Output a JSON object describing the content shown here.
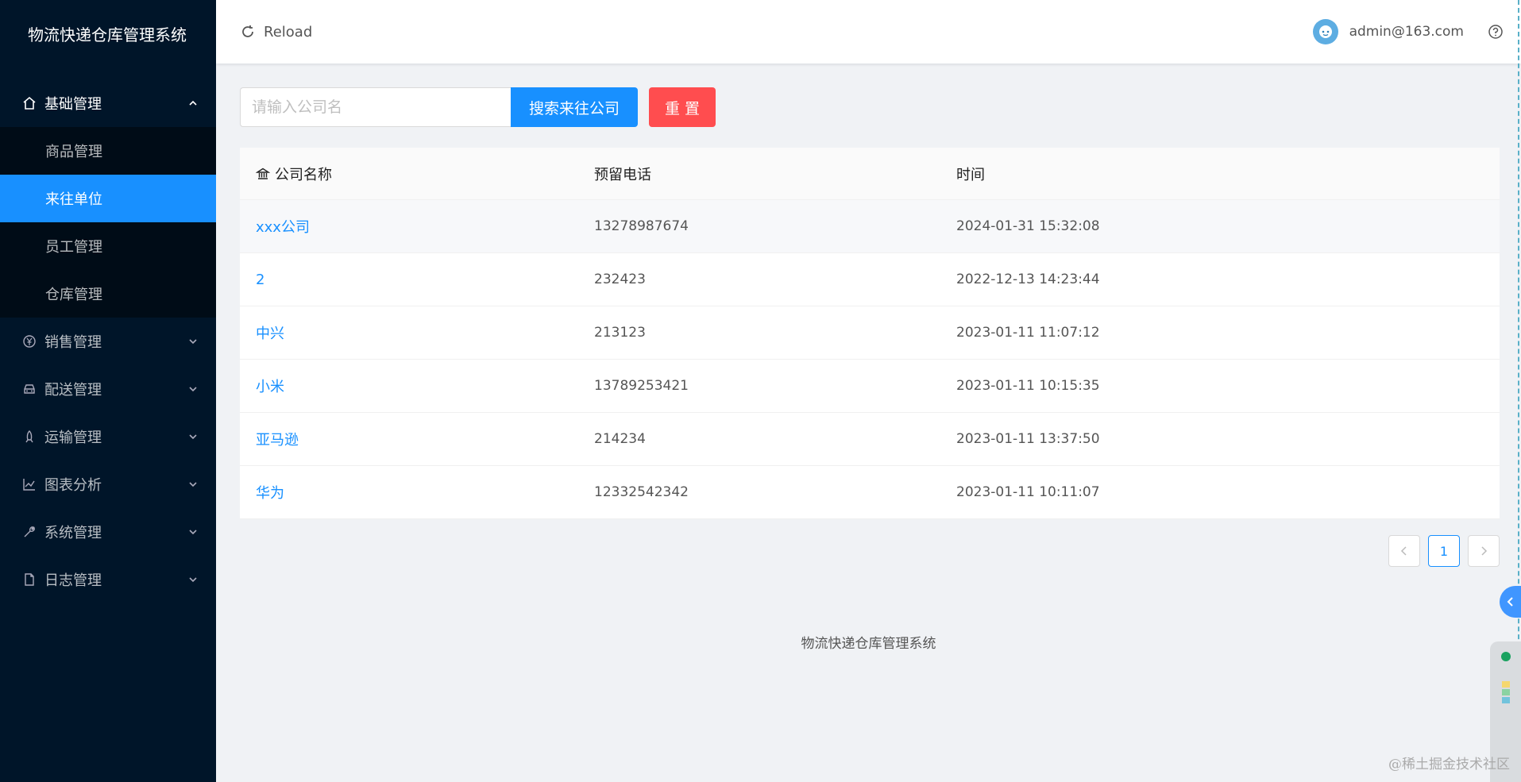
{
  "app": {
    "title": "物流快递仓库管理系统"
  },
  "sidebar": {
    "groups": [
      {
        "label": "基础管理",
        "icon": "home-icon",
        "open": true,
        "items": [
          {
            "label": "商品管理",
            "active": false
          },
          {
            "label": "来往单位",
            "active": true
          },
          {
            "label": "员工管理",
            "active": false
          },
          {
            "label": "仓库管理",
            "active": false
          }
        ]
      },
      {
        "label": "销售管理",
        "icon": "yen-icon"
      },
      {
        "label": "配送管理",
        "icon": "car-icon"
      },
      {
        "label": "运输管理",
        "icon": "rocket-icon"
      },
      {
        "label": "图表分析",
        "icon": "line-chart-icon"
      },
      {
        "label": "系统管理",
        "icon": "wrench-icon"
      },
      {
        "label": "日志管理",
        "icon": "file-icon"
      }
    ]
  },
  "header": {
    "reload_label": "Reload",
    "user_email": "admin@163.com"
  },
  "search": {
    "placeholder": "请输入公司名",
    "value": "",
    "search_button": "搜索来往公司",
    "reset_button": "重 置"
  },
  "table": {
    "columns": [
      "公司名称",
      "预留电话",
      "时间"
    ],
    "rows": [
      {
        "name": "xxx公司",
        "phone": "13278987674",
        "time": "2024-01-31 15:32:08"
      },
      {
        "name": "2",
        "phone": "232423",
        "time": "2022-12-13 14:23:44"
      },
      {
        "name": "中兴",
        "phone": "213123",
        "time": "2023-01-11 11:07:12"
      },
      {
        "name": "小米",
        "phone": "13789253421",
        "time": "2023-01-11 10:15:35"
      },
      {
        "name": "亚马逊",
        "phone": "214234",
        "time": "2023-01-11 13:37:50"
      },
      {
        "name": "华为",
        "phone": "12332542342",
        "time": "2023-01-11 10:11:07"
      }
    ]
  },
  "pagination": {
    "current_page": "1"
  },
  "footer": {
    "text": "物流快递仓库管理系统"
  },
  "watermark": {
    "text": "@稀土掘金技术社区"
  },
  "colors": {
    "sidebar_bg": "#001529",
    "primary": "#1890ff",
    "danger": "#ff4d4f"
  }
}
